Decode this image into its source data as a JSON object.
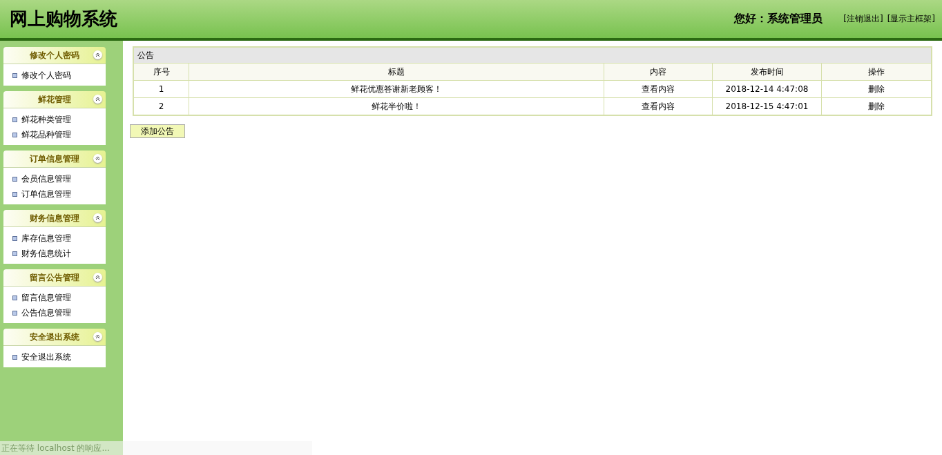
{
  "header": {
    "title": "网上购物系统",
    "greeting": "您好：系统管理员",
    "links": [
      "[注销退出]",
      "[显示主框架]"
    ]
  },
  "sidebar": {
    "sections": [
      {
        "title": "修改个人密码",
        "expanded": true,
        "items": [
          "修改个人密码"
        ]
      },
      {
        "title": "鲜花管理",
        "expanded": true,
        "items": [
          "鲜花种类管理",
          "鲜花品种管理"
        ]
      },
      {
        "title": "订单信息管理",
        "expanded": true,
        "items": [
          "会员信息管理",
          "订单信息管理"
        ]
      },
      {
        "title": "财务信息管理",
        "expanded": true,
        "items": [
          "库存信息管理",
          "财务信息统计"
        ]
      },
      {
        "title": "留言公告管理",
        "expanded": true,
        "items": [
          "留言信息管理",
          "公告信息管理"
        ]
      },
      {
        "title": "安全退出系统",
        "expanded": true,
        "items": [
          "安全退出系统"
        ]
      }
    ]
  },
  "panel": {
    "title": "公告",
    "table": {
      "columns": [
        "序号",
        "标题",
        "内容",
        "发布时间",
        "操作"
      ],
      "rows": [
        [
          "1",
          "鲜花优惠答谢新老顾客！",
          "查看内容",
          "2018-12-14 4:47:08",
          "删除"
        ],
        [
          "2",
          "鲜花半价啦！",
          "查看内容",
          "2018-12-15 4:47:01",
          "删除"
        ]
      ]
    },
    "add_button": "添加公告"
  },
  "status_bar": "正在等待 localhost 的响应..."
}
